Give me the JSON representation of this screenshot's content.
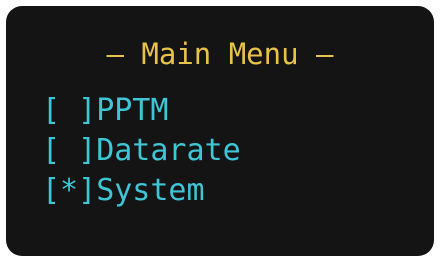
{
  "menu": {
    "title": "— Main Menu —",
    "items": [
      {
        "check": "[ ]",
        "label": "PPTM"
      },
      {
        "check": "[ ]",
        "label": "Datarate"
      },
      {
        "check": "[*]",
        "label": "System"
      }
    ]
  },
  "colors": {
    "background": "#141414",
    "title": "#e8c24a",
    "items": "#3ec6d6"
  }
}
